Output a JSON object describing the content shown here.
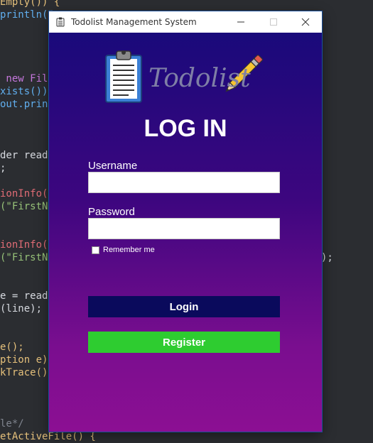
{
  "editor": {
    "lines": [
      {
        "text": "Empty()) {"
      },
      {
        "text": "println(\"",
        "color": "#d7dae0"
      },
      {
        "text": ""
      },
      {
        "text": ""
      },
      {
        "text": ""
      },
      {
        "text": " new File"
      },
      {
        "text": "xists())"
      },
      {
        "text": "out.print"
      },
      {
        "text": ""
      },
      {
        "text": ""
      },
      {
        "text": ""
      },
      {
        "text": "der reade"
      },
      {
        "text": ";"
      },
      {
        "text": ""
      },
      {
        "text": "ionInfo()"
      },
      {
        "text": "(\"FirstNa"
      },
      {
        "text": ""
      },
      {
        "text": ""
      },
      {
        "text": "ionInfo()"
      },
      {
        "text": "(\"FirstNa"
      },
      {
        "text": ""
      },
      {
        "text": ""
      },
      {
        "text": "e = reade"
      },
      {
        "text": "(line);"
      },
      {
        "text": ""
      },
      {
        "text": ""
      },
      {
        "text": "e();"
      },
      {
        "text": "ption e)"
      },
      {
        "text": "kTrace();"
      },
      {
        "text": ""
      },
      {
        "text": ""
      },
      {
        "text": ""
      },
      {
        "text": "le*/"
      },
      {
        "text": "etActiveFile() {"
      }
    ],
    "right_fragment": ");"
  },
  "window": {
    "title": "Todolist Management System"
  },
  "logo": {
    "text": "Todolist"
  },
  "form": {
    "heading": "LOG IN",
    "username_label": "Username",
    "username_value": "",
    "password_label": "Password",
    "password_value": "",
    "remember_label": "Remember me",
    "remember_checked": false,
    "login_label": "Login",
    "register_label": "Register"
  },
  "colors": {
    "login_button": "#0a0a5c",
    "register_button": "#2ecc30",
    "gradient_top": "#150a7a",
    "gradient_bottom": "#8c0f93"
  }
}
